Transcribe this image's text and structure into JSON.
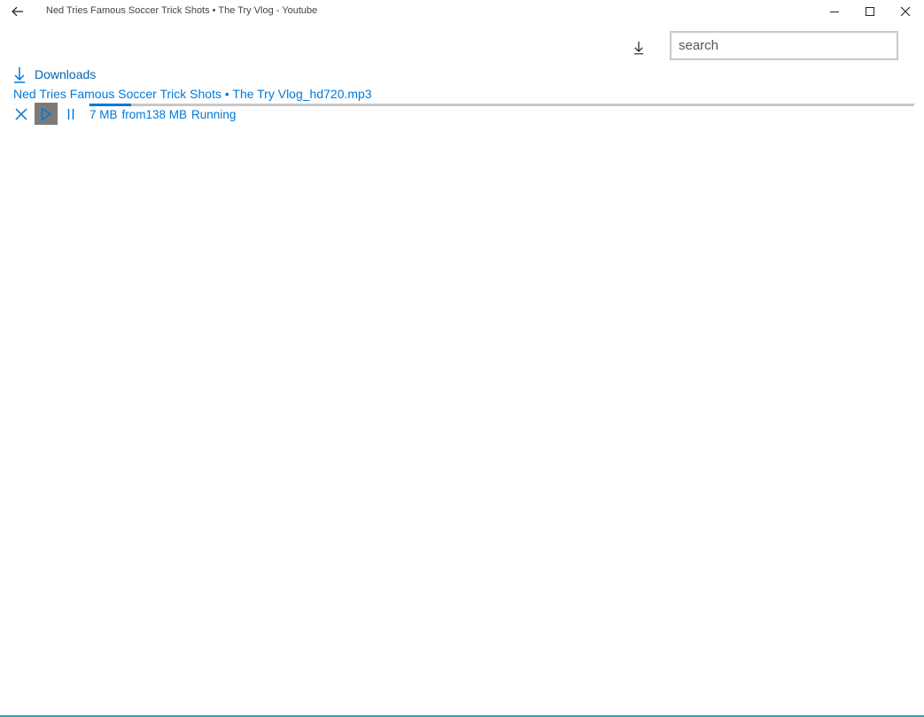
{
  "window": {
    "title": "Ned Tries Famous Soccer Trick Shots • The Try Vlog - Youtube"
  },
  "toolbar": {
    "download_icon": "download-icon"
  },
  "search": {
    "placeholder": "search",
    "value": ""
  },
  "downloads": {
    "header_label": "Downloads",
    "items": [
      {
        "file_name": "Ned Tries Famous Soccer Trick Shots • The Try Vlog_hd720.mp3",
        "downloaded": "7 MB",
        "from_total": "from138 MB",
        "status": "Running",
        "progress_fraction": 0.0507
      }
    ]
  },
  "colors": {
    "accent": "#0078d7",
    "play_button_bg": "#7a7a7a",
    "track": "#c8c8c8"
  }
}
